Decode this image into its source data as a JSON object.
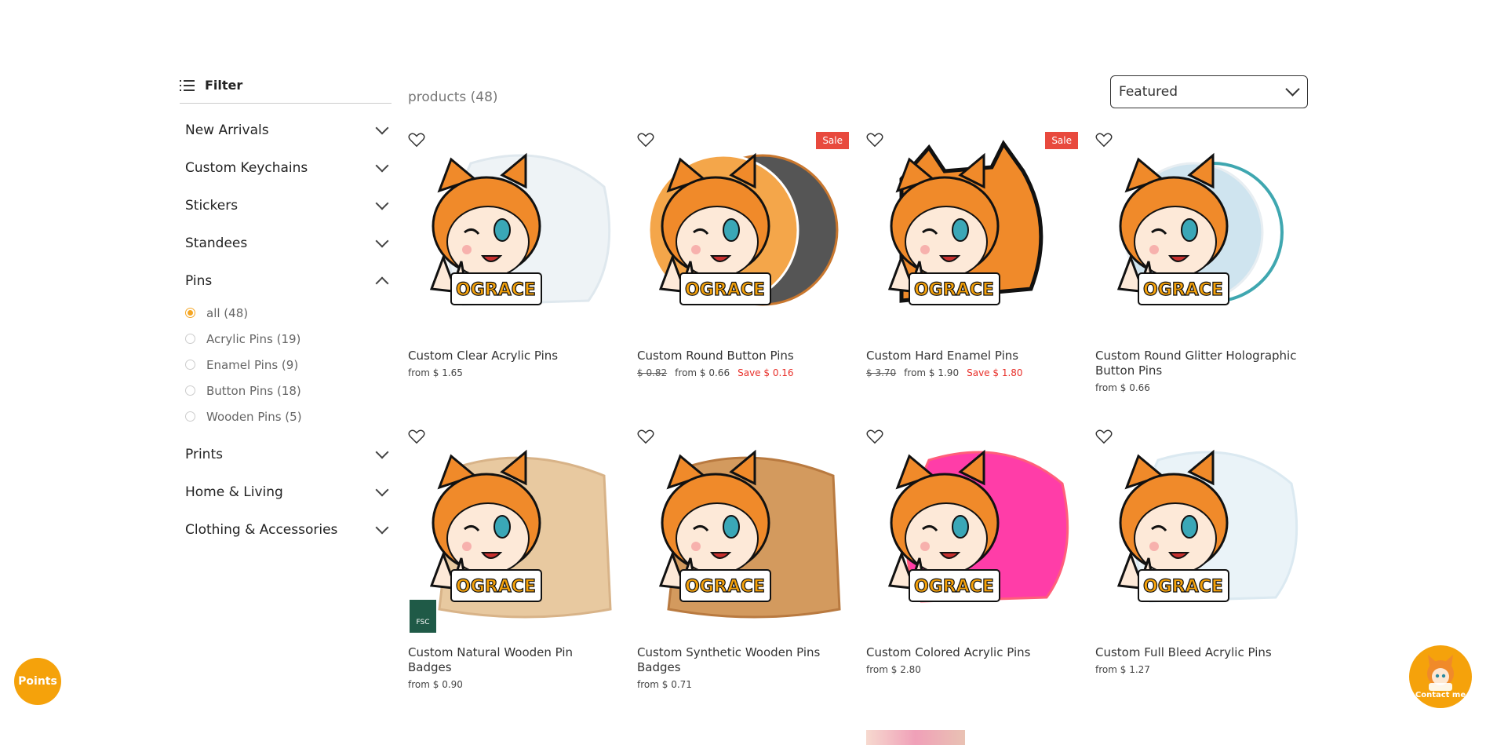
{
  "sidebar": {
    "filter_label": "Filter",
    "categories": [
      {
        "label": "New Arrivals"
      },
      {
        "label": "Custom Keychains"
      },
      {
        "label": "Stickers"
      },
      {
        "label": "Standees"
      },
      {
        "label": "Pins"
      },
      {
        "label": "Prints"
      },
      {
        "label": "Home & Living"
      },
      {
        "label": "Clothing & Accessories"
      }
    ],
    "pins_options": [
      {
        "label": "all (48)",
        "selected": true
      },
      {
        "label": "Acrylic Pins (19)"
      },
      {
        "label": "Enamel Pins (9)"
      },
      {
        "label": "Button Pins (18)"
      },
      {
        "label": "Wooden Pins (5)"
      }
    ]
  },
  "toolbar": {
    "count": "products (48)",
    "sort_value": "Featured"
  },
  "products": [
    {
      "title": "Custom Clear Acrylic Pins",
      "price": "from $ 1.65",
      "image": "clear-acrylic-pin"
    },
    {
      "title": "Custom Round Button Pins",
      "old_price": "$ 0.82",
      "price": "from $ 0.66",
      "save": "Save $ 0.16",
      "sale": "Sale",
      "image": "round-button-pin"
    },
    {
      "title": "Custom Hard Enamel Pins",
      "old_price": "$ 3.70",
      "price": "from $ 1.90",
      "save": "Save $ 1.80",
      "sale": "Sale",
      "image": "hard-enamel-pin"
    },
    {
      "title": "Custom Round Glitter Holographic Button Pins",
      "price": "from $ 0.66",
      "image": "glitter-holo-button-pin"
    },
    {
      "title": "Custom Natural Wooden Pin Badges",
      "price": "from $ 0.90",
      "image": "natural-wooden-pin",
      "badge": "FSC"
    },
    {
      "title": "Custom Synthetic Wooden Pins Badges",
      "price": "from $ 0.71",
      "image": "synthetic-wooden-pin"
    },
    {
      "title": "Custom Colored Acrylic Pins",
      "price": "from $ 2.80",
      "image": "colored-acrylic-pin"
    },
    {
      "title": "Custom Full Bleed Acrylic Pins",
      "price": "from $ 1.27",
      "image": "full-bleed-acrylic-pin"
    }
  ],
  "floating": {
    "points_label": "Points",
    "contact_label": "Contact me"
  },
  "logo_text": "OGRACE",
  "colors": {
    "accent": "#f5a20b",
    "sale": "#e8493d",
    "save": "#e8302a"
  }
}
